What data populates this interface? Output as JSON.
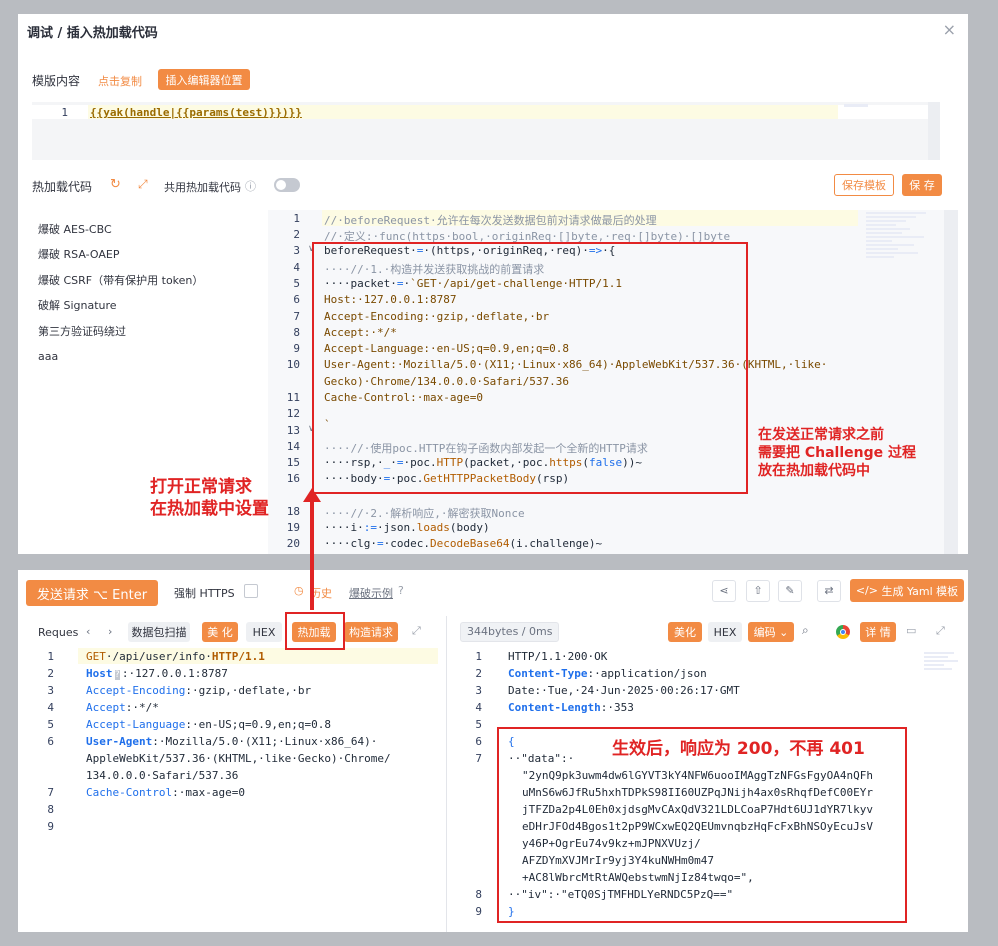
{
  "dialog": {
    "title": "调试 / 插入热加载代码",
    "template_label": "模版内容",
    "copy_link": "点击复制",
    "insert_button": "插入编辑器位置",
    "template_code": "{{yak(handle|{{params(test)}})}}",
    "hotload_label": "热加载代码",
    "share_label": "共用热加载代码",
    "save_template": "保存模板",
    "save": "保 存",
    "templates": [
      "爆破 AES-CBC",
      "爆破 RSA-OAEP",
      "爆破 CSRF（带有保护用 token）",
      "破解 Signature",
      "第三方验证码绕过",
      "aaa"
    ]
  },
  "code": {
    "l1": "//·beforeRequest·允许在每次发送数据包前对请求做最后的处理",
    "l2": "//·定义:·func(https·bool,·originReq·[]byte,·req·[]byte)·[]byte",
    "l4": "····//·1.·构造并发送获取挑战的前置请求",
    "l6": "Host:·127.0.0.1:8787",
    "l7": "Accept-Encoding:·gzip,·deflate,·br",
    "l8": "Accept:·*/*",
    "l9": "Accept-Language:·en-US;q=0.9,en;q=0.8",
    "l10a": "User-Agent:·Mozilla/5.0·(X11;·Linux·x86_64)·AppleWebKit/537.36·(KHTML,·like·",
    "l10b": "Gecko)·Chrome/134.0.0.0·Safari/537.36",
    "l11": "Cache-Control:·max-age=0",
    "l13": "`",
    "l14": "····//·使用poc.HTTP在钩子函数内部发起一个全新的HTTP请求",
    "l17": "····//·2.·解析响应,·解密获取Nonce"
  },
  "toolbar": {
    "send": "发送请求 ⌥ Enter",
    "force_https": "强制 HTTPS",
    "history": "历史",
    "examples": "爆破示例",
    "yaml": "生成 Yaml 模板"
  },
  "req": {
    "label": "Reques",
    "scan": "数据包扫描",
    "beautify": "美 化",
    "hex": "HEX",
    "hotload": "热加载",
    "build": "构造请求",
    "lines": {
      "l1a": "GET",
      "l1b": "·/api/user/info·",
      "l1c": "HTTP/1.1",
      "l2k": "Host",
      "l2v": ":·127.0.0.1:8787",
      "l3k": "Accept-Encoding",
      "l3v": ":·gzip,·deflate,·br",
      "l4k": "Accept",
      "l4v": ":·*/*",
      "l5k": "Accept-Language",
      "l5v": ":·en-US;q=0.9,en;q=0.8",
      "l6k": "User-Agent",
      "l6v": ":·Mozilla/5.0·(X11;·Linux·x86_64)·",
      "l6b": "AppleWebKit/537.36·(KHTML,·like·Gecko)·Chrome/",
      "l6c": "134.0.0.0·Safari/537.36",
      "l7k": "Cache-Control",
      "l7v": ":·max-age=0"
    }
  },
  "resp": {
    "size": "344bytes / 0ms",
    "beautify": "美化",
    "hex": "HEX",
    "encode": "编码",
    "detail": "详 情",
    "l1": "HTTP/1.1·200·OK",
    "l2k": "Content-Type",
    "l2v": ":·application/json",
    "l3": "Date:·Tue,·24·Jun·2025·00:26:17·GMT",
    "l4k": "Content-Length",
    "l4v": ":·353",
    "l6": "{",
    "l7": "··\"data\":·",
    "data": [
      "\"2ynQ9pk3uwm4dw6lGYVT3kY4NFW6uooIMAggTzNFGsFgyOA4nQFh",
      "uMnS6w6JfRu5hxhTDPkS98II60UZPqJNijh4ax0sRhqfDefC00EYr",
      "jTFZDa2p4L0Eh0xjdsgMvCAxQdV321LDLCoaP7Hdt6UJ1dYR7lkyv",
      "eDHrJFOd4Bgos1t2pP9WCxwEQ2QEUmvnqbzHqFcFxBhNSOyEcuJsV",
      "y46P+OgrEu74v9kz+mJPNXVUzj/",
      "AFZDYmXVJMrIr9yj3Y4kuNWHm0m47",
      "+AC8lWbrcMtRtAWQebstwmNjIz84twqo=\","
    ],
    "l8": "··\"iv\":·\"eTQ0SjTMFHDLYeRNDC5PzQ==\"",
    "l9": "}"
  },
  "annotations": {
    "a1": [
      "在发送正常请求之前",
      "需要把 Challenge 过程",
      "放在热加载代码中"
    ],
    "a2": [
      "打开正常请求",
      "在热加载中设置"
    ],
    "a3": "生效后，响应为 200，不再 401"
  },
  "colors": {
    "accent": "#f28b44",
    "annotation": "#e02424"
  }
}
